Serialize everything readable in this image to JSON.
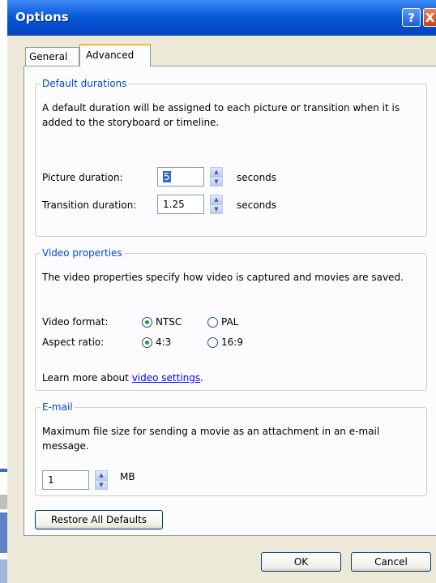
{
  "window": {
    "title": "Options"
  },
  "titlebar_buttons": {
    "help_glyph": "?",
    "close_glyph": "X"
  },
  "tabs": [
    {
      "label": "General"
    },
    {
      "label": "Advanced"
    }
  ],
  "durations": {
    "legend": "Default durations",
    "description": "A default duration will be assigned to each picture or transition when it is added to the storyboard or timeline.",
    "picture_label": "Picture duration:",
    "picture_value": "5",
    "transition_label": "Transition duration:",
    "transition_value": "1.25",
    "unit": "seconds"
  },
  "video": {
    "legend": "Video properties",
    "description": "The video properties specify how video is captured and movies are saved.",
    "format_label": "Video format:",
    "format_options": [
      "NTSC",
      "PAL"
    ],
    "format_selected": "NTSC",
    "aspect_label": "Aspect ratio:",
    "aspect_options": [
      "4:3",
      "16:9"
    ],
    "aspect_selected": "4:3",
    "learn_prefix": "Learn more about ",
    "learn_link": "video settings",
    "learn_suffix": "."
  },
  "email": {
    "legend": "E-mail",
    "description": "Maximum file size for sending a movie as an attachment in an e-mail message.",
    "value": "1",
    "unit": "MB"
  },
  "buttons": {
    "restore": "Restore All Defaults",
    "ok": "OK",
    "cancel": "Cancel"
  },
  "colors": {
    "titlebar": "#0a59d8",
    "face": "#ece9d8",
    "legend": "#0046d5"
  },
  "icons": {
    "spin_up": "spin-up-icon",
    "spin_down": "spin-down-icon"
  }
}
